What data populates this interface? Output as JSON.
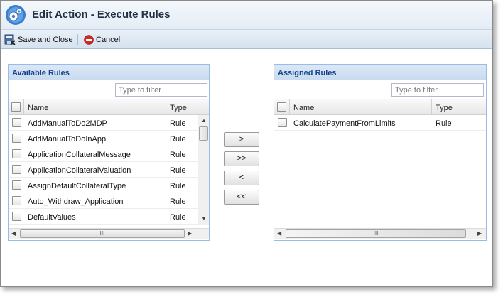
{
  "window": {
    "title": "Edit Action - Execute Rules"
  },
  "toolbar": {
    "save_close_label": "Save and Close",
    "cancel_label": "Cancel"
  },
  "available": {
    "title": "Available Rules",
    "filter_placeholder": "Type to filter",
    "columns": {
      "name": "Name",
      "type": "Type"
    },
    "rows": [
      {
        "name": "AddManualToDo2MDP",
        "type": "Rule"
      },
      {
        "name": "AddManualToDoInApp",
        "type": "Rule"
      },
      {
        "name": "ApplicationCollateralMessage",
        "type": "Rule"
      },
      {
        "name": "ApplicationCollateralValuation",
        "type": "Rule"
      },
      {
        "name": "AssignDefaultCollateralType",
        "type": "Rule"
      },
      {
        "name": "Auto_Withdraw_Application",
        "type": "Rule"
      },
      {
        "name": "DefaultValues",
        "type": "Rule"
      }
    ]
  },
  "assigned": {
    "title": "Assigned Rules",
    "filter_placeholder": "Type to filter",
    "columns": {
      "name": "Name",
      "type": "Type"
    },
    "rows": [
      {
        "name": "CalculatePaymentFromLimits",
        "type": "Rule"
      }
    ]
  },
  "move_buttons": {
    "add_one": ">",
    "add_all": ">>",
    "remove_one": "<",
    "remove_all": "<<"
  },
  "scrollbar": {
    "grip": "III"
  },
  "colors": {
    "panel_title": "#15428b",
    "panel_border": "#99bbe8",
    "cancel_icon": "#d62a1e"
  }
}
